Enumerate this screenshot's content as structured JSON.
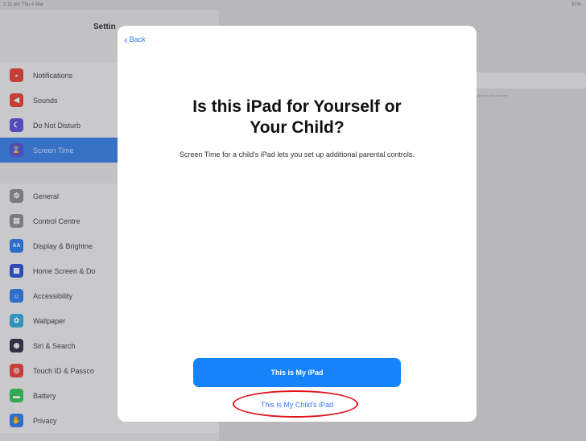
{
  "status_bar": {
    "left_text": "2:11 pm Thu 4 Mar",
    "right_text": "91%"
  },
  "sidebar": {
    "title": "Settin",
    "group1": [
      {
        "label": "Notifications",
        "icon": "notifications-icon",
        "color": "#e8443a",
        "glyph": "▪"
      },
      {
        "label": "Sounds",
        "icon": "sounds-icon",
        "color": "#e8443a",
        "glyph": "◀"
      },
      {
        "label": "Do Not Disturb",
        "icon": "moon-icon",
        "color": "#5b55d6",
        "glyph": "☾"
      },
      {
        "label": "Screen Time",
        "icon": "hourglass-icon",
        "color": "#5b55d6",
        "glyph": "⌛",
        "active": true
      }
    ],
    "group2": [
      {
        "label": "General",
        "icon": "gear-icon",
        "color": "#8e8e93",
        "glyph": "⚙"
      },
      {
        "label": "Control Centre",
        "icon": "control-centre-icon",
        "color": "#8e8e93",
        "glyph": "▤"
      },
      {
        "label": "Display & Brightne",
        "icon": "display-icon",
        "color": "#2f7df0",
        "glyph": "AA"
      },
      {
        "label": "Home Screen & Do",
        "icon": "home-screen-icon",
        "color": "#2f55d6",
        "glyph": "▦"
      },
      {
        "label": "Accessibility",
        "icon": "accessibility-icon",
        "color": "#2f7df0",
        "glyph": "☺"
      },
      {
        "label": "Wallpaper",
        "icon": "wallpaper-icon",
        "color": "#34aadc",
        "glyph": "✿"
      },
      {
        "label": "Siri & Search",
        "icon": "siri-icon",
        "color": "#333348",
        "glyph": "◉"
      },
      {
        "label": "Touch ID & Passco",
        "icon": "fingerprint-icon",
        "color": "#e8443a",
        "glyph": "◎"
      },
      {
        "label": "Battery",
        "icon": "battery-icon",
        "color": "#34c759",
        "glyph": "▬"
      },
      {
        "label": "Privacy",
        "icon": "hand-icon",
        "color": "#2f7df0",
        "glyph": "✋"
      }
    ]
  },
  "detail": {
    "note": "r data for your account"
  },
  "modal": {
    "back_label": "Back",
    "title_line1": "Is this iPad for Yourself or",
    "title_line2": "Your Child?",
    "description": "Screen Time for a child's iPad lets you set up additional parental controls.",
    "primary_button": "This is My iPad",
    "secondary_button": "This is My Child's iPad"
  },
  "colors": {
    "accent": "#3478f6",
    "primary_button": "#1683fb",
    "highlight": "#e0161d"
  }
}
